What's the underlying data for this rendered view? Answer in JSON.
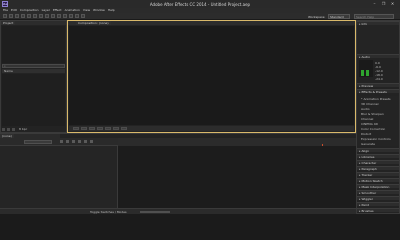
{
  "window": {
    "title": "Adobe After Effects CC 2014 - Untitled Project.aep",
    "app_icon_label": "Ae",
    "controls": [
      "–",
      "❐",
      "✕"
    ]
  },
  "menu": [
    "File",
    "Edit",
    "Composition",
    "Layer",
    "Effect",
    "Animation",
    "View",
    "Window",
    "Help"
  ],
  "toolbar": {
    "workspace_label": "Workspace:",
    "workspace_value": "Standard",
    "search_placeholder": "Search Help"
  },
  "panels": {
    "project_tab": "Project",
    "composition_tab": "Composition: (none)",
    "project_column_header": "Name",
    "bpc_label": "8 bpc",
    "timeline_tab": "(none)",
    "timeline_footer_label": "Toggle Switches / Modes"
  },
  "right_panels": {
    "info": "Info",
    "audio": "Audio",
    "audio_values": [
      "0.0",
      "-6.0",
      "-12.0",
      "-18.0",
      "-24.0"
    ],
    "preview": "Preview",
    "effects": "Effects & Presets",
    "effects_items": [
      "* Animation Presets",
      "3D Channel",
      "Audio",
      "Blur & Sharpen",
      "Channel",
      "CINEMA 4D",
      "Color Correction",
      "Distort",
      "Expression Controls",
      "Generate"
    ],
    "bottom": [
      "Align",
      "Libraries",
      "Character",
      "Paragraph",
      "Tracker",
      "Motion Sketch",
      "Mask Interpolation",
      "Smoother",
      "Wiggler",
      "Paint",
      "Brushes"
    ]
  },
  "colors": {
    "accent_active": "#d9b96a",
    "playhead": "#c94c2a",
    "meter": "#2fa52f"
  }
}
